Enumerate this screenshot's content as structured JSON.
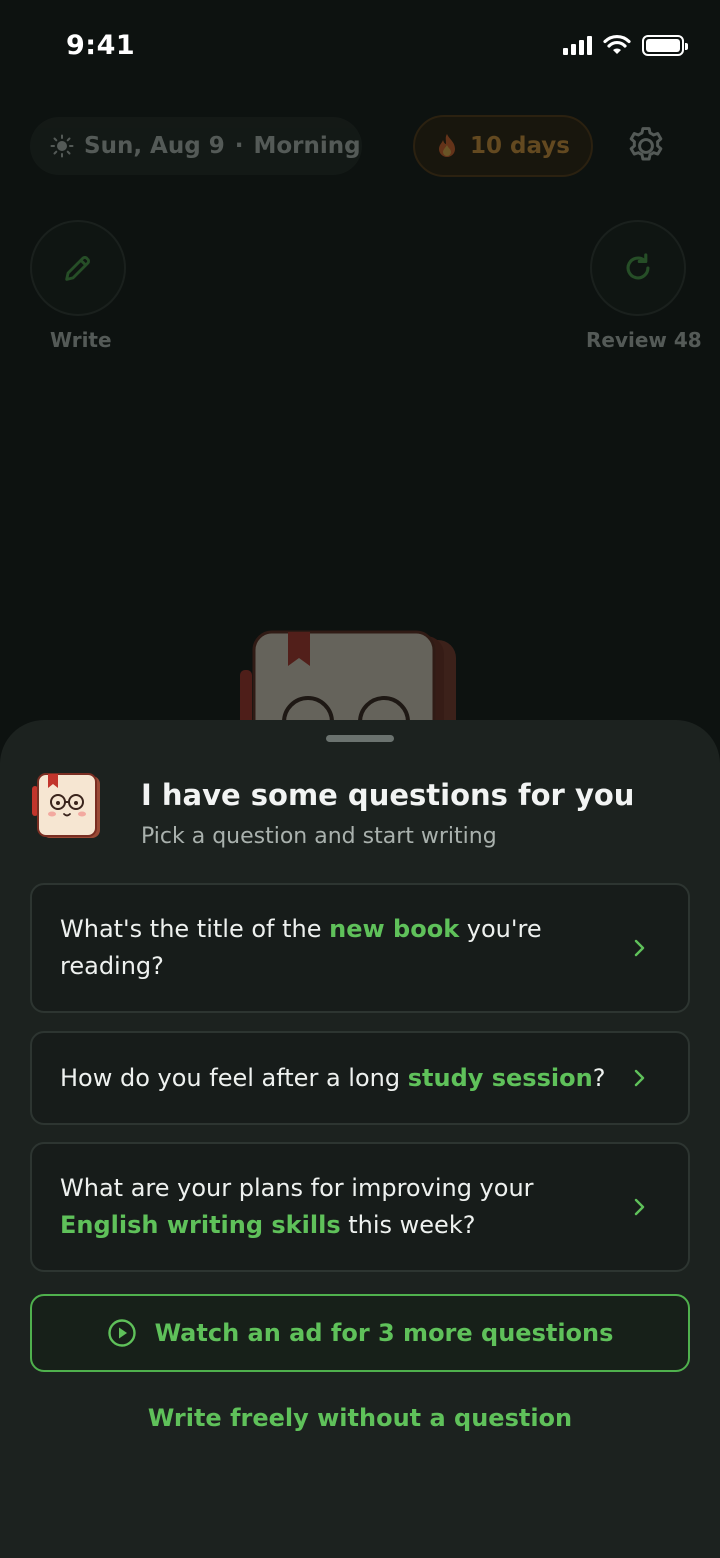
{
  "status_bar": {
    "time": "9:41"
  },
  "header": {
    "date_label": "Sun, Aug 9",
    "separator": "·",
    "period_label": "Morning",
    "streak_label": "10 days"
  },
  "actions": {
    "write_label": "Write",
    "review_label": "Review 48"
  },
  "sheet": {
    "title": "I have some questions for you",
    "subtitle": "Pick a question and start writing",
    "questions": [
      {
        "before": "What's the title of the ",
        "highlight": "new book",
        "after": " you're reading?"
      },
      {
        "before": "How do you feel after a long ",
        "highlight": "study session",
        "after": "?"
      },
      {
        "before": "What are your plans for improving your ",
        "highlight": "English writing skills",
        "after": " this week?"
      }
    ],
    "ad_button_label": "Watch an ad for 3 more questions",
    "free_write_label": "Write freely without a question"
  },
  "colors": {
    "accent_green": "#5fc15a",
    "streak_orange": "#f0a33a",
    "sheet_bg": "#1c221f",
    "card_bg": "#171c1a"
  },
  "icons": [
    "sun-icon",
    "fire-icon",
    "gear-icon",
    "pencil-icon",
    "refresh-icon",
    "notebook-mascot-icon",
    "chevron-right-icon",
    "play-circle-icon",
    "wifi-icon",
    "signal-icon",
    "battery-icon"
  ]
}
